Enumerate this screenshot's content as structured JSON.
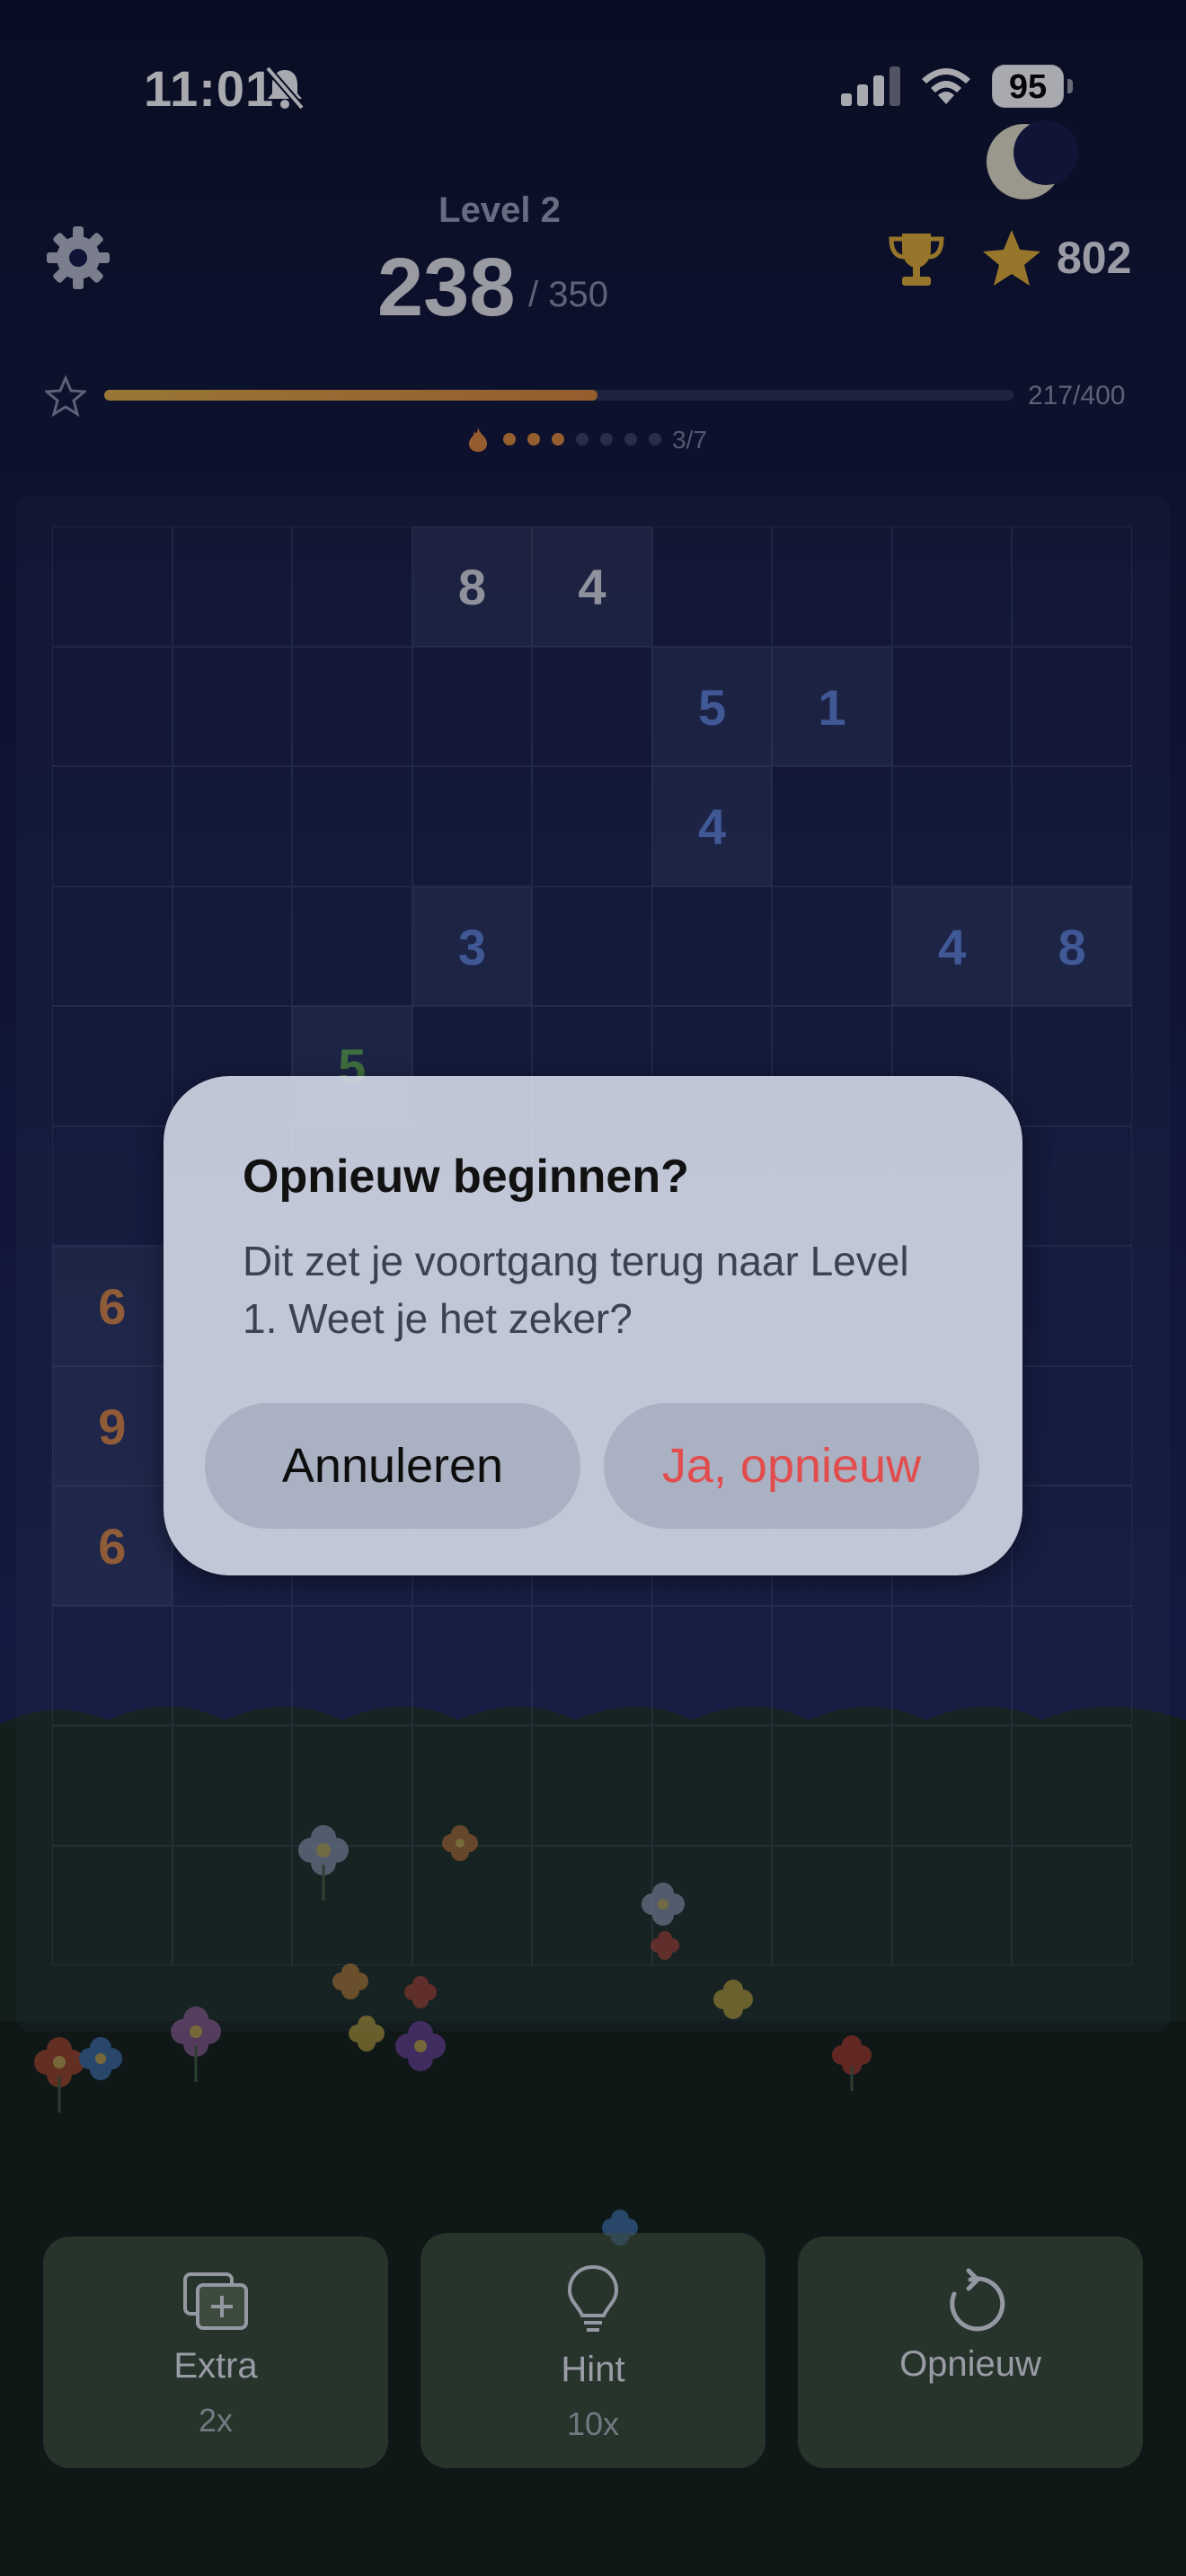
{
  "status_bar": {
    "time": "11:01",
    "battery": "95"
  },
  "header": {
    "level_label": "Level 2",
    "score": "238",
    "target": "/ 350",
    "coins": "802"
  },
  "progress": {
    "fraction": 0.5425,
    "label": "217/400"
  },
  "streak": {
    "filled": 3,
    "total": 7,
    "label": "3/7"
  },
  "grid": {
    "cols": 9,
    "rows": 12,
    "cells": [
      {
        "row": 0,
        "col": 3,
        "value": "8",
        "color": "#d8dae0"
      },
      {
        "row": 0,
        "col": 4,
        "value": "4",
        "color": "#d8dae0"
      },
      {
        "row": 1,
        "col": 5,
        "value": "5",
        "color": "#5e82d6"
      },
      {
        "row": 1,
        "col": 6,
        "value": "1",
        "color": "#5e82d6"
      },
      {
        "row": 2,
        "col": 5,
        "value": "4",
        "color": "#5e82d6"
      },
      {
        "row": 3,
        "col": 3,
        "value": "3",
        "color": "#5e82d6"
      },
      {
        "row": 3,
        "col": 7,
        "value": "4",
        "color": "#5e82d6"
      },
      {
        "row": 3,
        "col": 8,
        "value": "8",
        "color": "#5e82d6"
      },
      {
        "row": 4,
        "col": 2,
        "value": "5",
        "color": "#5fa552"
      },
      {
        "row": 6,
        "col": 0,
        "value": "6",
        "color": "#d98845"
      },
      {
        "row": 7,
        "col": 0,
        "value": "9",
        "color": "#d98845"
      },
      {
        "row": 8,
        "col": 0,
        "value": "6",
        "color": "#d98845"
      }
    ]
  },
  "actions": [
    {
      "label": "Extra",
      "count": "2x",
      "icon": "add-card-icon"
    },
    {
      "label": "Hint",
      "count": "10x",
      "icon": "lightbulb-icon"
    },
    {
      "label": "Opnieuw",
      "count": "",
      "icon": "restart-icon"
    }
  ],
  "dialog": {
    "title": "Opnieuw beginnen?",
    "message": "Dit zet je voortgang terug naar Level 1. Weet je het zeker?",
    "cancel_label": "Annuleren",
    "confirm_label": "Ja, opnieuw"
  },
  "colors": {
    "accent_gold": "#e7b043",
    "accent_orange": "#e08a3a",
    "danger": "#e24c4c",
    "blue_number": "#5e82d6",
    "green_number": "#5fa552",
    "orange_number": "#d98845"
  }
}
